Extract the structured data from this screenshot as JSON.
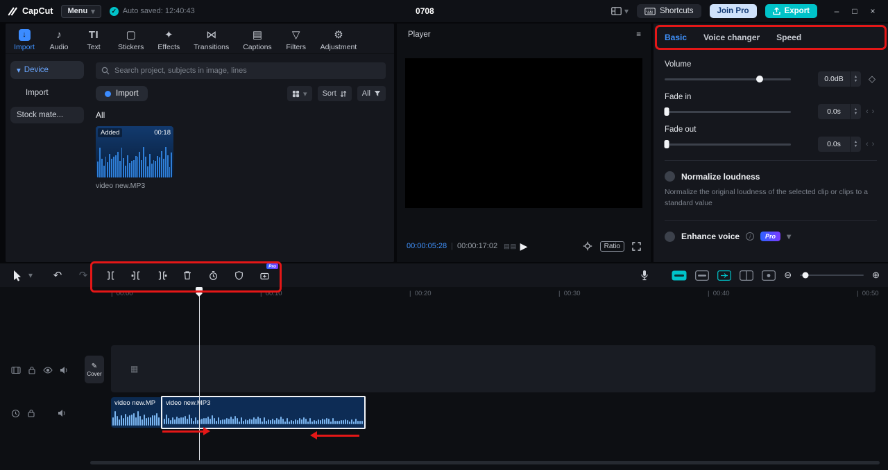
{
  "icons": {
    "caret_down": "▾",
    "check": "✓",
    "minimize": "–",
    "maximize": "□",
    "close": "×",
    "undo": "↶",
    "redo": "↷",
    "play": "▶",
    "hamburger": "≡",
    "diamond": "◇",
    "step_up": "▲",
    "step_down": "▼",
    "chevrons": "‹›",
    "zoom_out": "⊖",
    "zoom_in": "⊕",
    "pencil": "✎",
    "track_placeholder": "▦",
    "frames": "▤▤",
    "text_tool": "TI",
    "import_arrow": "↓",
    "audio_note": "♪",
    "sticker": "▢",
    "effects": "✦",
    "transitions": "⋈",
    "captions": "▤",
    "filters": "▽",
    "adjustment": "⚙"
  },
  "topbar": {
    "logo_text": "CapCut",
    "menu_label": "Menu",
    "autosave_text": "Auto saved: 12:40:43",
    "project_title": "0708",
    "shortcuts_label": "Shortcuts",
    "join_pro_label": "Join Pro",
    "export_label": "Export"
  },
  "ribbon": {
    "tabs": [
      {
        "label": "Import"
      },
      {
        "label": "Audio"
      },
      {
        "label": "Text"
      },
      {
        "label": "Stickers"
      },
      {
        "label": "Effects"
      },
      {
        "label": "Transitions"
      },
      {
        "label": "Captions"
      },
      {
        "label": "Filters"
      },
      {
        "label": "Adjustment"
      }
    ]
  },
  "sidebar": {
    "items": [
      {
        "label": "Device"
      },
      {
        "label": "Import"
      },
      {
        "label": "Stock mate..."
      }
    ]
  },
  "media_panel": {
    "search_placeholder": "Search project, subjects in image, lines",
    "import_button_label": "Import",
    "sort_label": "Sort",
    "filter_label": "All",
    "section_label": "All",
    "item": {
      "badge": "Added",
      "duration": "00:18",
      "filename": "video new.MP3"
    }
  },
  "player": {
    "title": "Player",
    "current_time": "00:00:05:28",
    "duration": "00:00:17:02",
    "ratio_label": "Ratio"
  },
  "inspector": {
    "tabs": [
      {
        "label": "Basic"
      },
      {
        "label": "Voice changer"
      },
      {
        "label": "Speed"
      }
    ],
    "volume_label": "Volume",
    "volume_value": "0.0dB",
    "fade_in_label": "Fade in",
    "fade_in_value": "0.0s",
    "fade_out_label": "Fade out",
    "fade_out_value": "0.0s",
    "normalize_label": "Normalize loudness",
    "normalize_desc": "Normalize the original loudness of the selected clip or clips to a standard value",
    "enhance_label": "Enhance voice",
    "pro_badge": "Pro"
  },
  "timeline": {
    "ruler_labels": [
      "00:00",
      "00:10",
      "00:20",
      "00:30",
      "00:40",
      "00:50"
    ],
    "cover_label": "Cover",
    "pro_badge": "Pro",
    "clips": {
      "left_label": "video new.MP",
      "selected_label": "video new.MP3"
    }
  }
}
